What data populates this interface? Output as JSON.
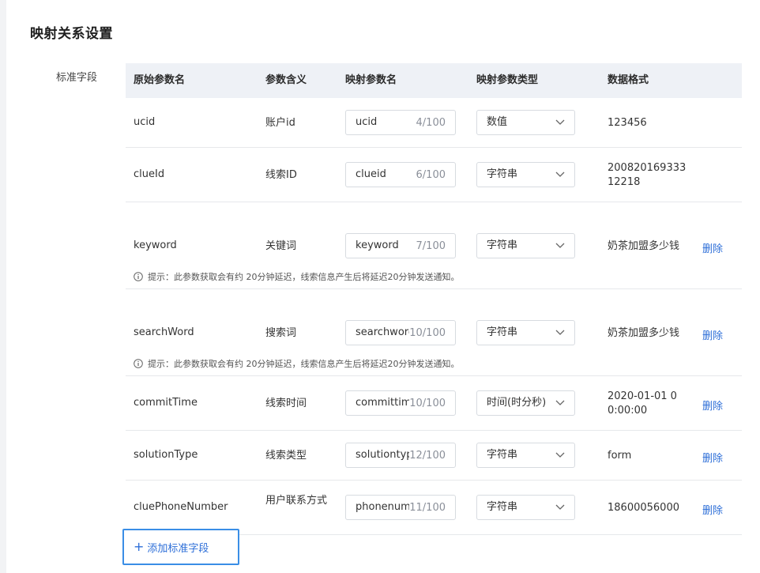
{
  "section_title": "映射关系设置",
  "form_label": "标准字段",
  "columns": {
    "orig": "原始参数名",
    "meaning": "参数含义",
    "mapped": "映射参数名",
    "type": "映射参数类型",
    "format": "数据格式"
  },
  "rows": [
    {
      "orig": "ucid",
      "meaning": "账户id",
      "input": "ucid",
      "count": "4/100",
      "type": "数值",
      "format": "123456",
      "delete": ""
    },
    {
      "orig": "clueId",
      "meaning": "线索ID",
      "input": "clueid",
      "count": "6/100",
      "type": "字符串",
      "format": "20082016933312218",
      "delete": ""
    },
    {
      "orig": "keyword",
      "meaning": "关键词",
      "input": "keyword",
      "count": "7/100",
      "type": "字符串",
      "format": "奶茶加盟多少钱",
      "delete": "删除",
      "tip": "提示：此参数获取会有约 20分钟延迟，线索信息产生后将延迟20分钟发送通知。"
    },
    {
      "orig": "searchWord",
      "meaning": "搜索词",
      "input": "searchword",
      "count": "10/100",
      "type": "字符串",
      "format": "奶茶加盟多少钱",
      "delete": "删除",
      "tip": "提示：此参数获取会有约 20分钟延迟，线索信息产生后将延迟20分钟发送通知。"
    },
    {
      "orig": "commitTime",
      "meaning": "线索时间",
      "input": "committime",
      "count": "10/100",
      "type": "时间(时分秒)",
      "format": "2020-01-01 00:00:00",
      "delete": "删除"
    },
    {
      "orig": "solutionType",
      "meaning": "线索类型",
      "input": "solutiontype",
      "count": "12/100",
      "type": "字符串",
      "format": "form",
      "delete": "删除"
    },
    {
      "orig": "cluePhoneNumber",
      "meaning": "用户联系方式",
      "input": "phonenumber",
      "count": "11/100",
      "type": "字符串",
      "format": "18600056000",
      "delete": "删除"
    }
  ],
  "add_button": "添加标准字段",
  "colors": {
    "accent": "#2e6fd8",
    "header_bg": "#eef1f6"
  }
}
